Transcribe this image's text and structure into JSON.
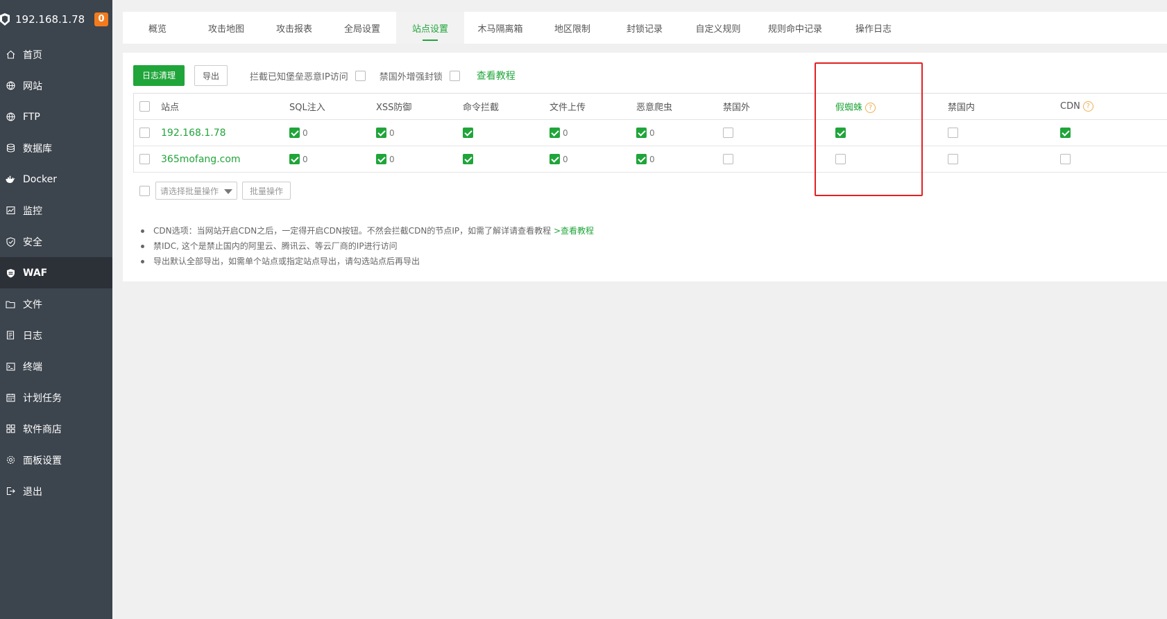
{
  "sidebar": {
    "ip": "192.168.1.78",
    "badge": "0",
    "items": [
      {
        "label": "首页",
        "icon": "home-icon"
      },
      {
        "label": "网站",
        "icon": "globe-icon"
      },
      {
        "label": "FTP",
        "icon": "globe-icon"
      },
      {
        "label": "数据库",
        "icon": "database-icon"
      },
      {
        "label": "Docker",
        "icon": "docker-icon"
      },
      {
        "label": "监控",
        "icon": "monitor-icon"
      },
      {
        "label": "安全",
        "icon": "shield-icon"
      },
      {
        "label": "WAF",
        "icon": "waf-shield-icon",
        "active": true
      },
      {
        "label": "文件",
        "icon": "folder-icon"
      },
      {
        "label": "日志",
        "icon": "log-icon"
      },
      {
        "label": "终端",
        "icon": "terminal-icon"
      },
      {
        "label": "计划任务",
        "icon": "calendar-icon"
      },
      {
        "label": "软件商店",
        "icon": "grid-icon"
      },
      {
        "label": "面板设置",
        "icon": "gear-icon"
      },
      {
        "label": "退出",
        "icon": "logout-icon"
      }
    ]
  },
  "tabs": [
    {
      "label": "概览"
    },
    {
      "label": "攻击地图"
    },
    {
      "label": "攻击报表"
    },
    {
      "label": "全局设置"
    },
    {
      "label": "站点设置",
      "active": true
    },
    {
      "label": "木马隔离箱"
    },
    {
      "label": "地区限制"
    },
    {
      "label": "封锁记录"
    },
    {
      "label": "自定义规则"
    },
    {
      "label": "规则命中记录"
    },
    {
      "label": "操作日志"
    }
  ],
  "toolbar": {
    "clear_log": "日志清理",
    "export": "导出",
    "block_bastion_label": "拦截已知堡垒恶意IP访问",
    "block_foreign_label": "禁国外增强封锁",
    "tutorial": "查看教程"
  },
  "table": {
    "headers": {
      "site": "站点",
      "sql": "SQL注入",
      "xss": "XSS防御",
      "cmd": "命令拦截",
      "upload": "文件上传",
      "crawler": "恶意爬虫",
      "foreign": "禁国外",
      "spider": "假蜘蛛",
      "domestic": "禁国内",
      "cdn": "CDN"
    },
    "help_glyph": "?",
    "rows": [
      {
        "site": "192.168.1.78",
        "sql": "0",
        "xss": "0",
        "upload": "0",
        "crawler": "0",
        "spider": true,
        "cdn": true
      },
      {
        "site": "365mofang.com",
        "sql": "0",
        "xss": "0",
        "upload": "0",
        "crawler": "0",
        "spider": false,
        "cdn": false
      }
    ]
  },
  "batch": {
    "placeholder": "请选择批量操作",
    "button": "批量操作"
  },
  "notes": {
    "n1": "CDN选项：当网站开启CDN之后，一定得开启CDN按钮。不然会拦截CDN的节点IP，如需了解详请查看教程",
    "n1_link": ">查看教程",
    "n2": "禁IDC, 这个是禁止国内的阿里云、腾讯云、等云厂商的IP进行访问",
    "n3": "导出默认全部导出，如需单个站点或指定站点导出，请勾选站点后再导出"
  },
  "colors": {
    "accent": "#20a53a",
    "sidebar": "#3c444d",
    "sidebar_active": "#2c3138",
    "badge": "#f37b1d",
    "highlight": "#e02020",
    "help": "#f0ad4e"
  }
}
